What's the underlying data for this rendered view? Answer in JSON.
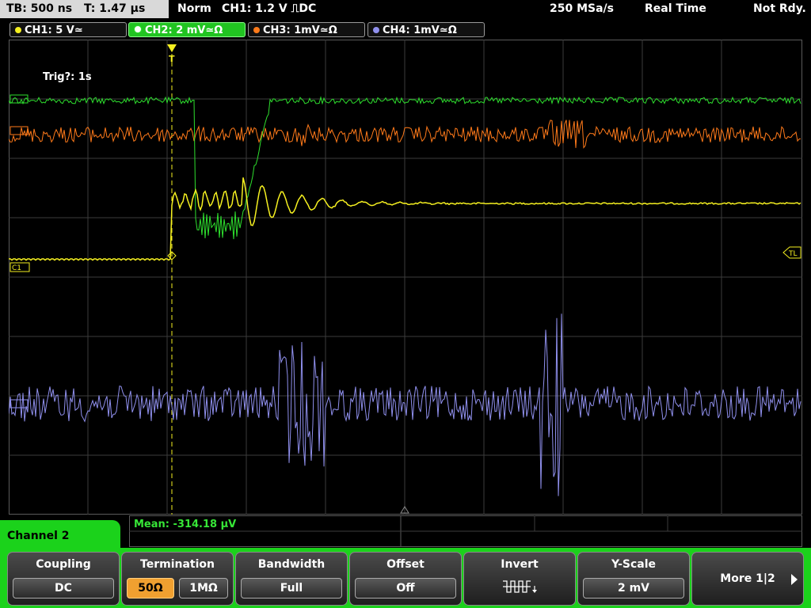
{
  "status": {
    "timebase": "TB: 500 ns",
    "trigger_time": "T: 1.47 µs",
    "trigger_mode": "Norm",
    "trigger_source": "CH1: 1.2 V ⎍DC",
    "sample_rate": "250 MSa/s",
    "acq_mode": "Real Time",
    "state": "Not Rdy."
  },
  "channels": [
    {
      "label": "CH1: 5 V≃",
      "color": "#f5f020"
    },
    {
      "label": "CH2: 2 mV≃Ω",
      "color": "#2ee02e"
    },
    {
      "label": "CH3: 1mV≃Ω",
      "color": "#ff7a1a"
    },
    {
      "label": "CH4: 1mV≃Ω",
      "color": "#9090ee"
    }
  ],
  "screen": {
    "trig_info": "Trig?: 1s",
    "ch1_marker": "C1",
    "trigger_level_marker": "TL",
    "trigger_pos_marker": "T"
  },
  "measurement": {
    "mean": "Mean: -314.18 µV"
  },
  "menu": {
    "channel_tab": "Channel 2",
    "coupling": {
      "title": "Coupling",
      "value": "DC"
    },
    "termination": {
      "title": "Termination",
      "opt1": "50Ω",
      "opt2": "1MΩ"
    },
    "bandwidth": {
      "title": "Bandwidth",
      "value": "Full"
    },
    "offset": {
      "title": "Offset",
      "value": "Off"
    },
    "invert": {
      "title": "Invert"
    },
    "yscale": {
      "title": "Y-Scale",
      "value": "2 mV"
    },
    "more": {
      "title": "More 1|2"
    }
  }
}
